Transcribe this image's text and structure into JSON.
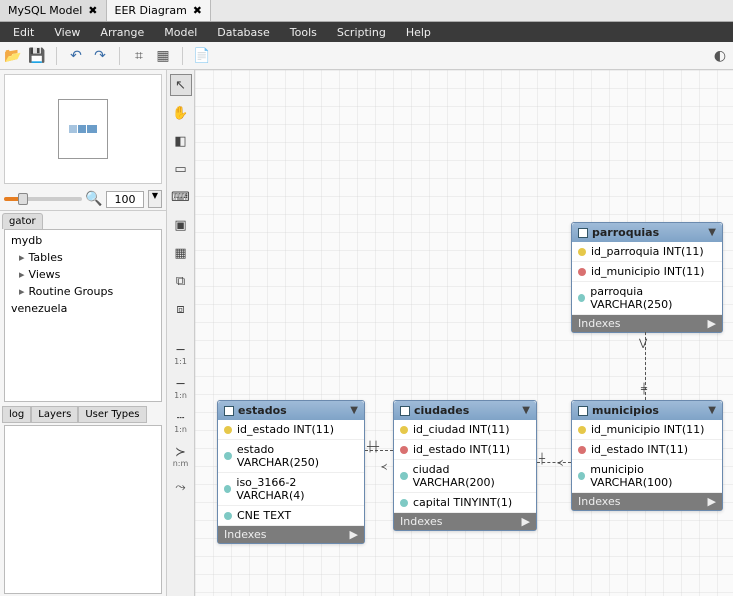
{
  "tabs": [
    {
      "label": "MySQL Model",
      "close": "✖"
    },
    {
      "label": "EER Diagram",
      "close": "✖"
    }
  ],
  "menubar": [
    "Edit",
    "View",
    "Arrange",
    "Model",
    "Database",
    "Tools",
    "Scripting",
    "Help"
  ],
  "zoom": {
    "value": "100",
    "dropdown": "▼"
  },
  "nav_tab": "gator",
  "tree": {
    "root1": "mydb",
    "items": [
      "Tables",
      "Views",
      "Routine Groups"
    ],
    "root2": "venezuela"
  },
  "bottom_tabs": [
    "log",
    "Layers",
    "User Types"
  ],
  "toolstrip_labels": {
    "t11": "1:1",
    "t1n": "1:n",
    "t1n2": "1:n",
    "tnm": "n:m"
  },
  "tables": {
    "estados": {
      "name": "estados",
      "rows": [
        {
          "icon": "ci-key",
          "text": "id_estado INT(11)"
        },
        {
          "icon": "ci-col",
          "text": "estado VARCHAR(250)"
        },
        {
          "icon": "ci-col",
          "text": "iso_3166-2 VARCHAR(4)"
        },
        {
          "icon": "ci-col",
          "text": "CNE TEXT"
        }
      ],
      "footer": "Indexes"
    },
    "ciudades": {
      "name": "ciudades",
      "rows": [
        {
          "icon": "ci-key",
          "text": "id_ciudad INT(11)"
        },
        {
          "icon": "ci-fk",
          "text": "id_estado INT(11)"
        },
        {
          "icon": "ci-col",
          "text": "ciudad VARCHAR(200)"
        },
        {
          "icon": "ci-col",
          "text": "capital TINYINT(1)"
        }
      ],
      "footer": "Indexes"
    },
    "municipios": {
      "name": "municipios",
      "rows": [
        {
          "icon": "ci-key",
          "text": "id_municipio INT(11)"
        },
        {
          "icon": "ci-fk",
          "text": "id_estado INT(11)"
        },
        {
          "icon": "ci-col",
          "text": "municipio VARCHAR(100)"
        }
      ],
      "footer": "Indexes"
    },
    "parroquias": {
      "name": "parroquias",
      "rows": [
        {
          "icon": "ci-key",
          "text": "id_parroquia INT(11)"
        },
        {
          "icon": "ci-fk",
          "text": "id_municipio INT(11)"
        },
        {
          "icon": "ci-col",
          "text": "parroquia VARCHAR(250)"
        }
      ],
      "footer": "Indexes"
    }
  }
}
